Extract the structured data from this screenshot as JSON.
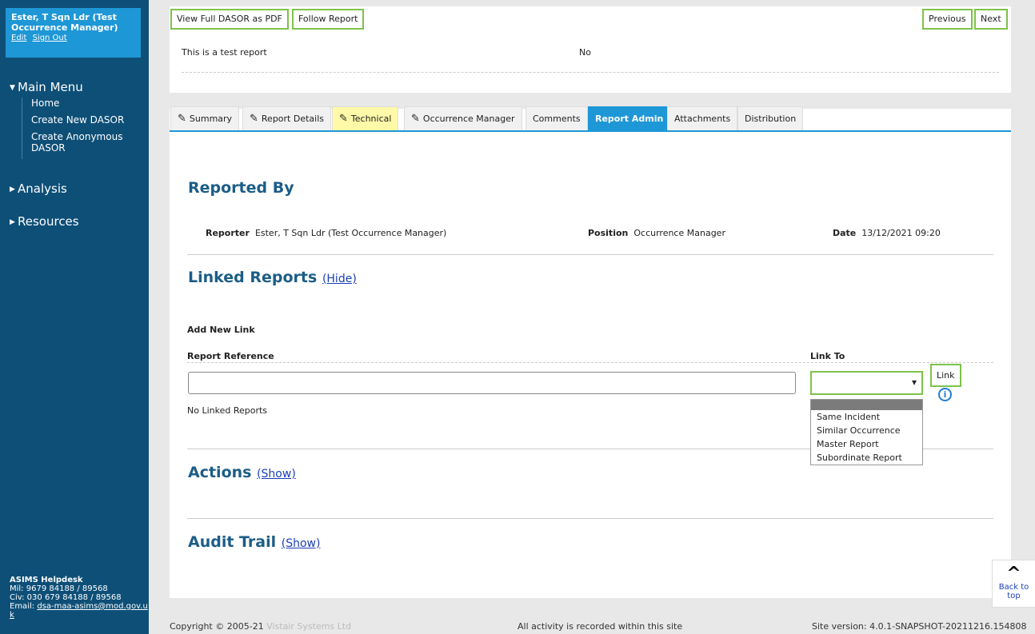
{
  "user": {
    "name": "Ester, T Sqn Ldr (Test Occurrence Manager)",
    "edit_link": "Edit",
    "signout_link": "Sign Out"
  },
  "menu": {
    "main_menu": "Main Menu",
    "items": [
      "Home",
      "Create New DASOR",
      "Create Anonymous DASOR"
    ],
    "analysis": "Analysis",
    "resources": "Resources"
  },
  "helpdesk": {
    "title": "ASIMS Helpdesk",
    "mil": "Mil: 9679 84188 / 89568",
    "civ": "Civ: 030 679 84188 / 89568",
    "email_label": "Email:",
    "email": "dsa-maa-asims@mod.gov.uk"
  },
  "toolbar": {
    "pdf": "View Full DASOR as PDF",
    "follow": "Follow Report",
    "previous": "Previous",
    "next": "Next"
  },
  "summary": {
    "text": "This is a test report",
    "value": "No"
  },
  "tabs": [
    {
      "label": "Summary"
    },
    {
      "label": "Report Details"
    },
    {
      "label": "Technical"
    },
    {
      "label": "Occurrence Manager"
    },
    {
      "label": "Comments"
    },
    {
      "label": "Report Admin"
    },
    {
      "label": "Attachments"
    },
    {
      "label": "Distribution"
    }
  ],
  "reported_by": {
    "heading": "Reported By",
    "reporter_label": "Reporter",
    "reporter": "Ester, T Sqn Ldr (Test Occurrence Manager)",
    "position_label": "Position",
    "position": "Occurrence Manager",
    "date_label": "Date",
    "date": "13/12/2021 09:20"
  },
  "linked": {
    "heading": "Linked Reports",
    "toggle": "(Hide)",
    "add_new": "Add New Link",
    "ref_label": "Report Reference",
    "link_to_label": "Link To",
    "link_button": "Link",
    "none": "No Linked Reports",
    "options": [
      "",
      "Same Incident",
      "Similar Occurrence",
      "Master Report",
      "Subordinate Report"
    ]
  },
  "actions": {
    "heading": "Actions",
    "toggle": "(Show)"
  },
  "audit": {
    "heading": "Audit Trail",
    "toggle": "(Show)"
  },
  "footer": {
    "copyright": "Copyright © 2005-21",
    "company": "Vistair Systems Ltd",
    "activity": "All activity is recorded within this site",
    "version": "Site version: 4.0.1-SNAPSHOT-20211216.154808"
  },
  "back_to_top": {
    "line1": "Back to",
    "line2": "top"
  }
}
